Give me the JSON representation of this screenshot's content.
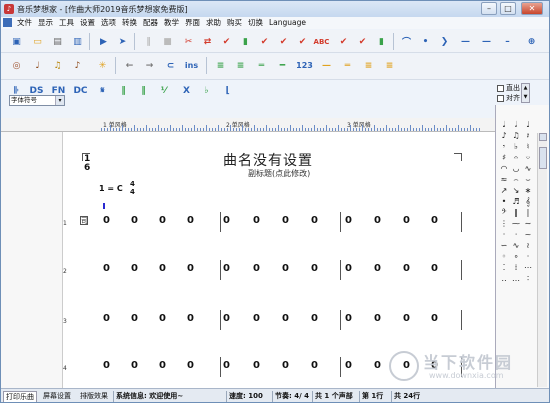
{
  "window": {
    "title": "音乐梦想家 - [作曲大师2019音乐梦想家免费版]",
    "minimize_label": "–",
    "maximize_label": "□",
    "close_label": "✕"
  },
  "menu": {
    "items": [
      "文件",
      "显示",
      "工具",
      "设置",
      "选项",
      "转换",
      "配器",
      "教学",
      "界面",
      "求助",
      "购买",
      "切换",
      "Language"
    ]
  },
  "toolbar3": {
    "font_select_value": "字体符号",
    "labels": [
      "DS",
      "FN",
      "DC"
    ]
  },
  "toolbar2": {
    "ins_label": "ins",
    "num_label": "123"
  },
  "checkboxes": {
    "c1": "直出",
    "c2": "对齐"
  },
  "ruler": {
    "labels": [
      "1 单风格",
      "2 单风格",
      "3 单风格"
    ]
  },
  "score": {
    "title": "曲名没有设置",
    "subtitle": "副标题(点此修改)",
    "tempo_top": "1",
    "tempo_bottom": "6",
    "key": "1 = C",
    "timesig_top": "4",
    "timesig_bottom": "4",
    "cursor_mark": "I",
    "brace": "司",
    "system_numbers": [
      "1",
      "2",
      "3",
      "4"
    ],
    "note": "0"
  },
  "status": {
    "tabs": [
      "打印乐曲",
      "屏幕设置",
      "排版效果"
    ],
    "system_info": "系统信息: 欢迎使用~",
    "speed": "速度: 100",
    "beat": "节奏: 4/ 4",
    "voices": "共 1 个声部",
    "row": "第 1行",
    "total_rows": "共 24行"
  },
  "watermark": {
    "text": "当下软件园",
    "url": "www.downxia.com"
  },
  "colors": {
    "accent": "#3d6db8",
    "toolbar_green": "#3aa24a",
    "toolbar_red": "#d33b2c"
  }
}
